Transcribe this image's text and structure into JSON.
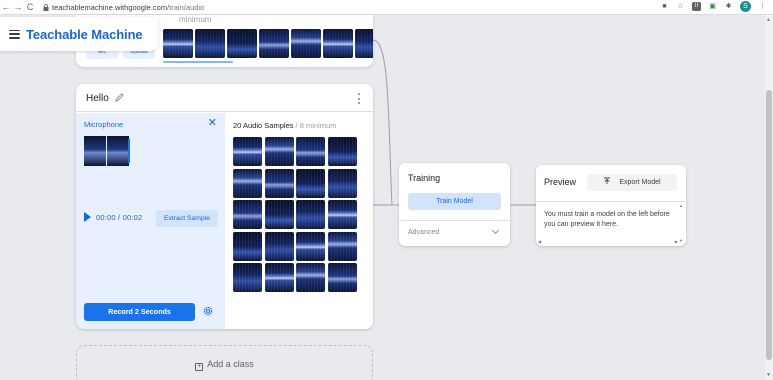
{
  "browser": {
    "url_domain": "teachablemachine.withgoogle.com",
    "url_path": "/train/audio",
    "avatar_letter": "S"
  },
  "app": {
    "title": "Teachable Machine"
  },
  "prev_class": {
    "faded_text": "minimum",
    "mic_label": "Mic",
    "upload_label": "Upload",
    "thumb_count": 7
  },
  "class_card": {
    "name": "Hello",
    "mic_panel": {
      "title": "Microphone",
      "timecode": "00:00 / 00:02",
      "extract_label": "Extract Sample",
      "record_label": "Record 2 Seconds"
    },
    "samples": {
      "count_label": "20 Audio Samples",
      "minimum_label": " / 8 minimum",
      "count": 20
    }
  },
  "add_class": {
    "label": "Add a class"
  },
  "training": {
    "title": "Training",
    "train_label": "Train Model",
    "advanced_label": "Advanced"
  },
  "preview": {
    "title": "Preview",
    "export_label": "Export Model",
    "message": "You must train a model on the left before you can preview it here."
  },
  "colors": {
    "brand_blue": "#1967d2",
    "primary_button": "#1a73e8",
    "panel_light_blue": "#e8f0fe",
    "button_light_blue": "#d2e3fc",
    "page_background": "#e8eaed"
  }
}
